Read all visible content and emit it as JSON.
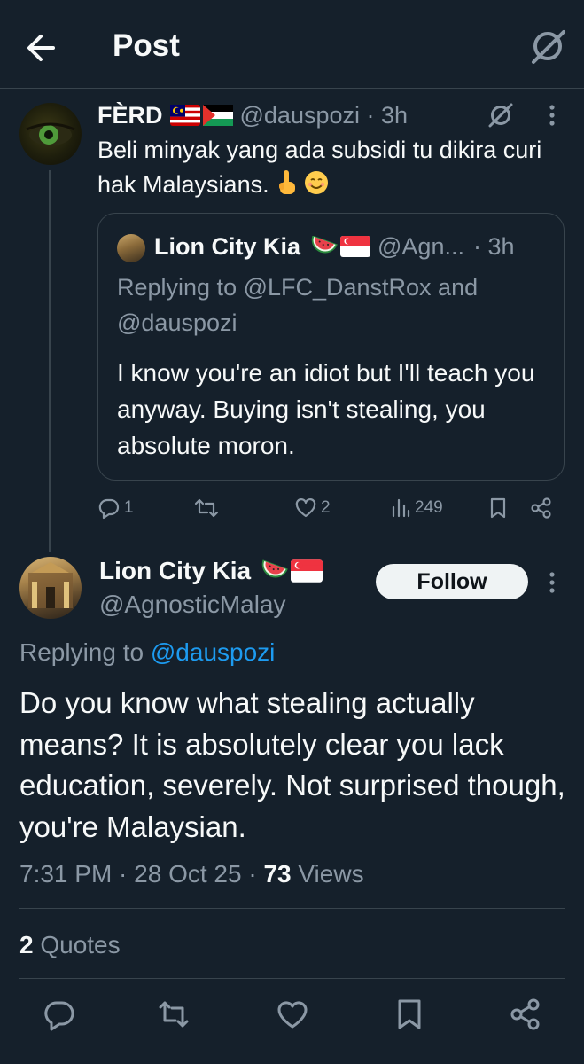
{
  "header": {
    "title": "Post"
  },
  "parent_tweet": {
    "name": "FÈRD",
    "flags": [
      "malaysia-flag",
      "palestine-flag"
    ],
    "handle_time": "@dauspozi · 3h",
    "text": "Beli minyak yang ada subsidi tu dikira curi hak Malaysians.",
    "emojis": [
      "index-pointing-up-emoji",
      "smiling-face-emoji"
    ],
    "stats": {
      "replies": "1",
      "reposts": "",
      "likes": "2",
      "views": "249"
    }
  },
  "quoted_tweet": {
    "name": "Lion City Kia",
    "flags": [
      "watermelon-emoji",
      "singapore-flag"
    ],
    "handle": "@Agn...",
    "time": "· 3h",
    "replying": "Replying to @LFC_DanstRox and @dauspozi",
    "text": "I know you're an idiot but I'll teach you anyway. Buying isn't stealing, you absolute moron."
  },
  "main_tweet": {
    "name": "Lion City Kia",
    "flags": [
      "watermelon-emoji",
      "singapore-flag"
    ],
    "handle": "@AgnosticMalay",
    "follow_label": "Follow",
    "replying_prefix": "Replying to ",
    "replying_handle": "@dauspozi",
    "text": "Do you know what stealing actually means? It is absolutely clear you lack education, severely. Not surprised though, you're Malaysian.",
    "time_date": "7:31 PM · 28 Oct 25 · ",
    "views_count": "73",
    "views_label": " Views",
    "quotes_count": "2",
    "quotes_label": " Quotes"
  },
  "colors": {
    "background": "#15202b",
    "text": "#f7f9f9",
    "secondary": "#8b98a5",
    "link": "#1d9bf0",
    "border": "#38444d"
  }
}
